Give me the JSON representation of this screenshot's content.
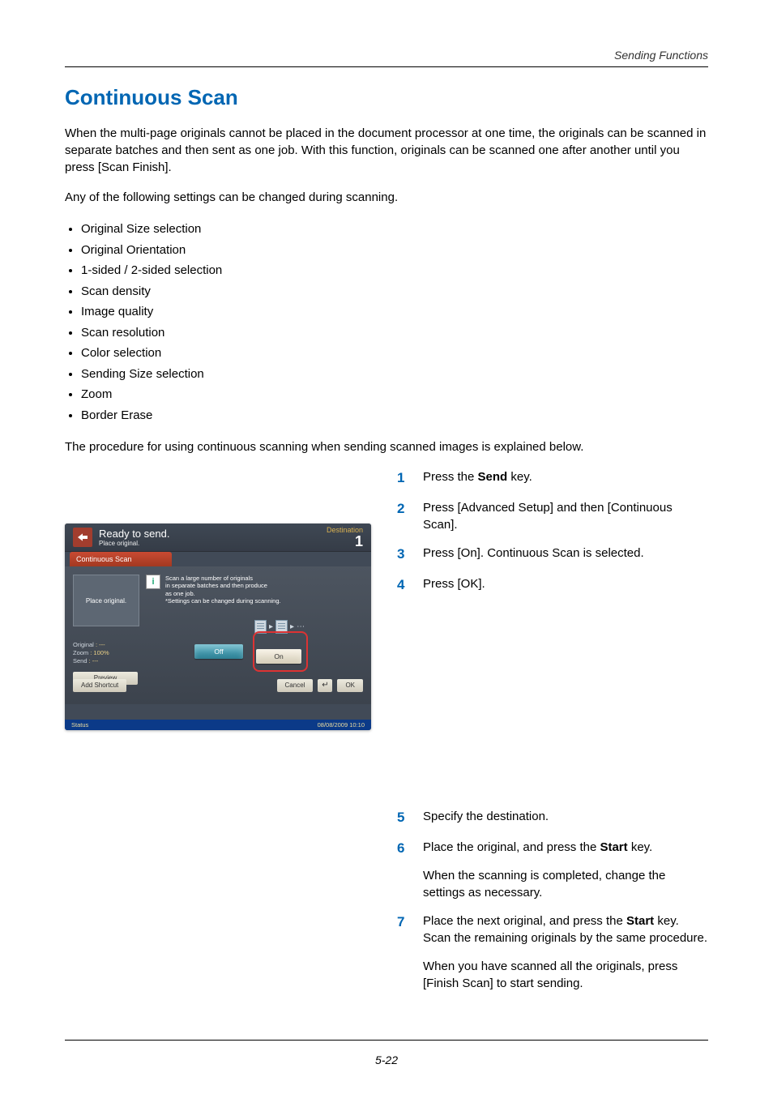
{
  "header": {
    "section": "Sending Functions"
  },
  "title": "Continuous Scan",
  "paragraphs": {
    "intro": "When the multi-page originals cannot be placed in the document processor at one time, the originals can be scanned in separate batches and then sent as one job. With this function, originals can be scanned one after another until you press [Scan Finish].",
    "settingsLead": "Any of the following settings can be changed during scanning.",
    "procedureLead": "The procedure for using continuous scanning when sending scanned images is explained below."
  },
  "settingsList": [
    "Original Size selection",
    "Original Orientation",
    "1-sided / 2-sided selection",
    "Scan density",
    "Image quality",
    "Scan resolution",
    "Color selection",
    "Sending Size selection",
    "Zoom",
    "Border Erase"
  ],
  "steps": {
    "s1": {
      "num": "1",
      "pre": "Press the ",
      "bold": "Send",
      "post": " key."
    },
    "s2": {
      "num": "2",
      "text": "Press [Advanced Setup] and then [Continuous Scan]."
    },
    "s3": {
      "num": "3",
      "text": "Press [On]. Continuous Scan is selected."
    },
    "s4": {
      "num": "4",
      "text": "Press [OK]."
    },
    "s5": {
      "num": "5",
      "text": "Specify the destination."
    },
    "s6": {
      "num": "6",
      "pre": "Place the original, and press the ",
      "bold": "Start",
      "post": " key.",
      "sub": "When the scanning is completed, change the settings as necessary."
    },
    "s7": {
      "num": "7",
      "pre": "Place the next original, and press the ",
      "bold": "Start",
      "post": " key. Scan the remaining originals by the same procedure.",
      "sub": "When you have scanned all the originals, press [Finish Scan] to start sending."
    }
  },
  "panel": {
    "readyLine": "Ready to send.",
    "readySub": "Place original.",
    "destinationLabel": "Destination",
    "destinationCount": "1",
    "tab": "Continuous Scan",
    "placeOriginal": "Place original.",
    "infoIcon": "i",
    "info1": "Scan a large number of originals",
    "info2": "in separate batches and then produce",
    "info3": "as one job.",
    "info4": "*Settings can be changed during scanning.",
    "stat1Label": "Original",
    "stat1Val": ": ---",
    "stat2Label": "Zoom",
    "stat2Val": ": 100%",
    "stat3Label": "Send",
    "stat3Val": ": ---",
    "off": "Off",
    "on": "On",
    "preview": "Preview",
    "addShortcut": "Add Shortcut",
    "cancel": "Cancel",
    "enter": "↵",
    "ok": "OK",
    "status": "Status",
    "datetime": "08/08/2009    10:10"
  },
  "footer": {
    "pageNum": "5-22"
  }
}
